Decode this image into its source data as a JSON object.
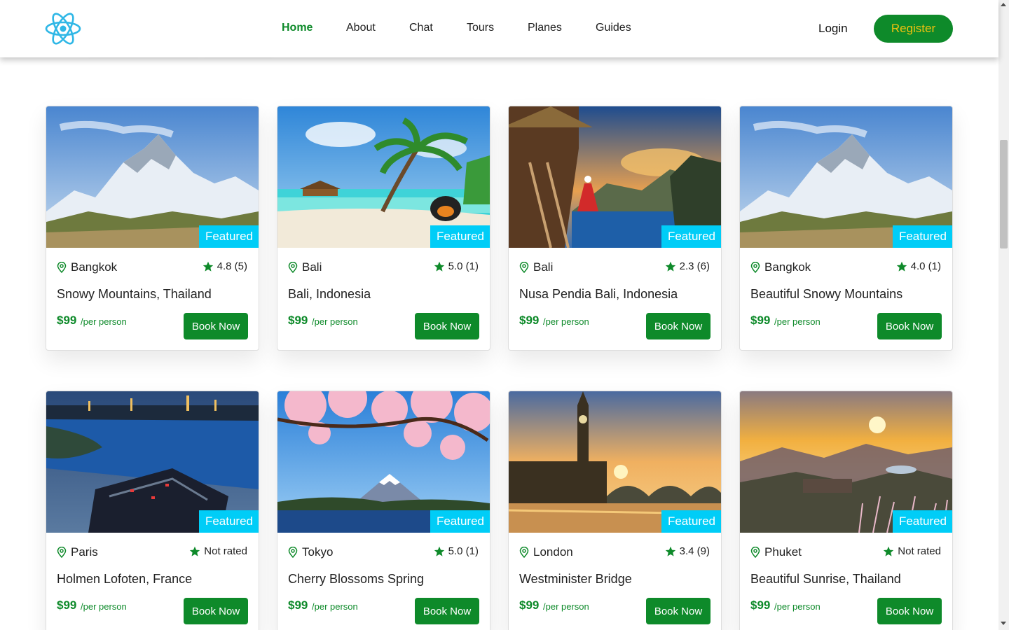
{
  "header": {
    "logo_name": "react-atom-logo",
    "nav": [
      {
        "label": "Home",
        "active": true
      },
      {
        "label": "About",
        "active": false
      },
      {
        "label": "Chat",
        "active": false
      },
      {
        "label": "Tours",
        "active": false
      },
      {
        "label": "Planes",
        "active": false
      },
      {
        "label": "Guides",
        "active": false
      }
    ],
    "login_label": "Login",
    "register_label": "Register"
  },
  "colors": {
    "brand_green": "#0e8a2a",
    "register_text": "#f1c20f",
    "featured_badge": "#00cdf7",
    "star": "#0e8a2a"
  },
  "tours": [
    {
      "image": "snowy-mountains",
      "badge": "Featured",
      "city": "Bangkok",
      "rating": "4.8 (5)",
      "title": "Snowy Mountains, Thailand",
      "price": "$99",
      "per": "/per person",
      "button": "Book Now"
    },
    {
      "image": "tropical-beach",
      "badge": "Featured",
      "city": "Bali",
      "rating": "5.0 (1)",
      "title": "Bali, Indonesia",
      "price": "$99",
      "per": "/per person",
      "button": "Book Now"
    },
    {
      "image": "treehouse-sunset",
      "badge": "Featured",
      "city": "Bali",
      "rating": "2.3 (6)",
      "title": "Nusa Pendia Bali, Indonesia",
      "price": "$99",
      "per": "/per person",
      "button": "Book Now"
    },
    {
      "image": "snowy-mountains",
      "badge": "Featured",
      "city": "Bangkok",
      "rating": "4.0 (1)",
      "title": "Beautiful Snowy Mountains",
      "price": "$99",
      "per": "/per person",
      "button": "Book Now"
    },
    {
      "image": "night-city-lake",
      "badge": "Featured",
      "city": "Paris",
      "rating": "Not rated",
      "title": "Holmen Lofoten, France",
      "price": "$99",
      "per": "/per person",
      "button": "Book Now"
    },
    {
      "image": "cherry-blossom-fuji",
      "badge": "Featured",
      "city": "Tokyo",
      "rating": "5.0 (1)",
      "title": "Cherry Blossoms Spring",
      "price": "$99",
      "per": "/per person",
      "button": "Book Now"
    },
    {
      "image": "big-ben-sunset",
      "badge": "Featured",
      "city": "London",
      "rating": "3.4 (9)",
      "title": "Westminister Bridge",
      "price": "$99",
      "per": "/per person",
      "button": "Book Now"
    },
    {
      "image": "mountain-sunrise",
      "badge": "Featured",
      "city": "Phuket",
      "rating": "Not rated",
      "title": "Beautiful Sunrise, Thailand",
      "price": "$99",
      "per": "/per person",
      "button": "Book Now"
    }
  ]
}
